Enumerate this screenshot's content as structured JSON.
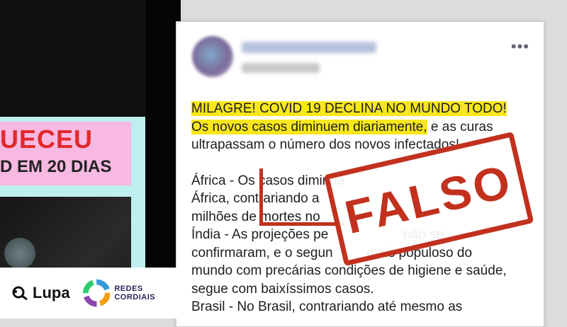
{
  "left_media": {
    "banner_top": "UECEU",
    "banner_bottom": "D EM 20 DIAS"
  },
  "logos": {
    "lupa": "Lupa",
    "cordiais": "REDES CORDIAIS"
  },
  "post": {
    "more_icon": "•••",
    "line1": "MILAGRE! COVID 19 DECLINA NO MUNDO TODO!",
    "line2_highlight": "Os novos casos diminuem diariamente,",
    "line2_rest": " e as curas",
    "line3": "ultrapassam o número dos novos infectados!",
    "line4": "África - Os casos diminue",
    "line5": "África, contrariando a",
    "line6": "milhões de mortes no",
    "line7": "Índia - As projeções pe                    não se",
    "line8": "confirmaram, e o segun         mais populoso do",
    "line9": "mundo com precárias condições de higiene e saúde,",
    "line10": "segue com baixíssimos casos.",
    "line11": "Brasil - No Brasil, contrariando até mesmo as"
  },
  "stamp": {
    "label": "FALSO",
    "color": "#c1311e"
  }
}
